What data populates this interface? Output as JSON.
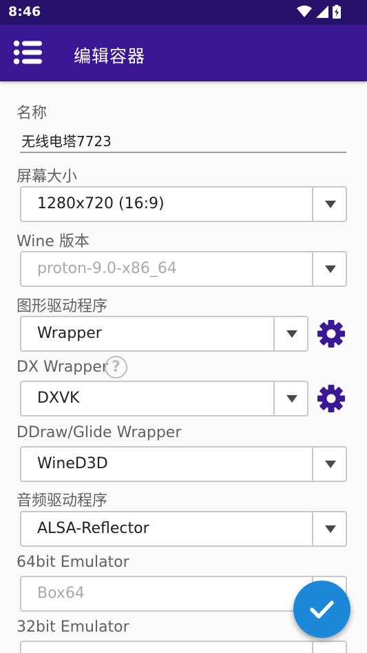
{
  "status_bar": {
    "time": "8:46"
  },
  "app_bar": {
    "title": "编辑容器"
  },
  "form": {
    "name_label": "名称",
    "name_value": "无线电塔7723",
    "screen_size_label": "屏幕大小",
    "screen_size_value": "1280x720 (16:9)",
    "wine_label": "Wine 版本",
    "wine_value": "proton-9.0-x86_64",
    "graphics_label": "图形驱动程序",
    "graphics_value": "Wrapper",
    "dx_label": "DX Wrapper",
    "dx_help": "?",
    "dx_value": "DXVK",
    "ddraw_label": "DDraw/Glide Wrapper",
    "ddraw_value": "WineD3D",
    "audio_label": "音频驱动程序",
    "audio_value": "ALSA-Reflector",
    "emu64_label": "64bit Emulator",
    "emu64_value": "Box64",
    "emu32_label": "32bit Emulator",
    "emu32_value": ""
  },
  "icons": {
    "menu": "menu-list-icon",
    "settings": "gear-icon",
    "help": "help-circle-icon",
    "confirm": "check-icon"
  },
  "colors": {
    "status_bar": "#26116a",
    "app_bar": "#3a1795",
    "gear": "#3a1795",
    "fab": "#1e88d8"
  }
}
